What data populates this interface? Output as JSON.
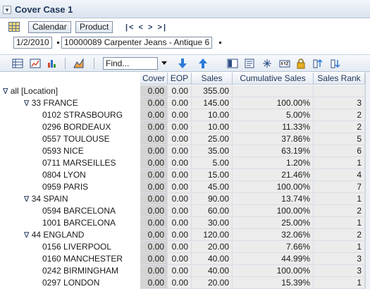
{
  "title": "Cover Case 1",
  "collapse_glyph": "▾",
  "dimensions": {
    "calendar_label": "Calendar",
    "product_label": "Product",
    "nav_glyphs": "|< < > >|",
    "date_crumb": "1/2/2010",
    "product_crumb": "10000089 Carpenter Jeans - Antique 6"
  },
  "toolbar": {
    "find_placeholder": "Find...",
    "icons": [
      "grid-view-icon",
      "chart-view-icon",
      "bar-chart-icon",
      "area-chart-icon",
      "find-next-icon",
      "find-previous-icon",
      "spreadsheet-icon",
      "filter-icon",
      "xyz-icon",
      "lock-icon",
      "sort-up-icon",
      "sort-down-icon"
    ]
  },
  "grid": {
    "columns": [
      "Cover",
      "EOP",
      "Sales",
      "Cumulative Sales",
      "Sales Rank"
    ],
    "rows": [
      {
        "label": "all [Location]",
        "twisty": "∇",
        "cover": "0.00",
        "eop": "0.00",
        "sales": "355.00",
        "cum": "",
        "rank": ""
      },
      {
        "label": "33 FRANCE",
        "twisty": "∇",
        "cover": "0.00",
        "eop": "0.00",
        "sales": "145.00",
        "cum": "100.00%",
        "rank": "3"
      },
      {
        "label": "0102 STRASBOURG",
        "twisty": "",
        "cover": "0.00",
        "eop": "0.00",
        "sales": "10.00",
        "cum": "5.00%",
        "rank": "2"
      },
      {
        "label": "0296 BORDEAUX",
        "twisty": "",
        "cover": "0.00",
        "eop": "0.00",
        "sales": "10.00",
        "cum": "11.33%",
        "rank": "2"
      },
      {
        "label": "0557 TOULOUSE",
        "twisty": "",
        "cover": "0.00",
        "eop": "0.00",
        "sales": "25.00",
        "cum": "37.86%",
        "rank": "5"
      },
      {
        "label": "0593 NICE",
        "twisty": "",
        "cover": "0.00",
        "eop": "0.00",
        "sales": "35.00",
        "cum": "63.19%",
        "rank": "6"
      },
      {
        "label": "0711 MARSEILLES",
        "twisty": "",
        "cover": "0.00",
        "eop": "0.00",
        "sales": "5.00",
        "cum": "1.20%",
        "rank": "1"
      },
      {
        "label": "0804 LYON",
        "twisty": "",
        "cover": "0.00",
        "eop": "0.00",
        "sales": "15.00",
        "cum": "21.46%",
        "rank": "4"
      },
      {
        "label": "0959 PARIS",
        "twisty": "",
        "cover": "0.00",
        "eop": "0.00",
        "sales": "45.00",
        "cum": "100.00%",
        "rank": "7"
      },
      {
        "label": "34 SPAIN",
        "twisty": "∇",
        "cover": "0.00",
        "eop": "0.00",
        "sales": "90.00",
        "cum": "13.74%",
        "rank": "1"
      },
      {
        "label": "0594 BARCELONA",
        "twisty": "",
        "cover": "0.00",
        "eop": "0.00",
        "sales": "60.00",
        "cum": "100.00%",
        "rank": "2"
      },
      {
        "label": "1001 BARCELONA",
        "twisty": "",
        "cover": "0.00",
        "eop": "0.00",
        "sales": "30.00",
        "cum": "25.00%",
        "rank": "1"
      },
      {
        "label": "44 ENGLAND",
        "twisty": "∇",
        "cover": "0.00",
        "eop": "0.00",
        "sales": "120.00",
        "cum": "32.06%",
        "rank": "2"
      },
      {
        "label": "0156 LIVERPOOL",
        "twisty": "",
        "cover": "0.00",
        "eop": "0.00",
        "sales": "20.00",
        "cum": "7.66%",
        "rank": "1"
      },
      {
        "label": "0160 MANCHESTER",
        "twisty": "",
        "cover": "0.00",
        "eop": "0.00",
        "sales": "40.00",
        "cum": "44.99%",
        "rank": "3"
      },
      {
        "label": "0242 BIRMINGHAM",
        "twisty": "",
        "cover": "0.00",
        "eop": "0.00",
        "sales": "40.00",
        "cum": "100.00%",
        "rank": "3"
      },
      {
        "label": "0297 LONDON",
        "twisty": "",
        "cover": "0.00",
        "eop": "0.00",
        "sales": "20.00",
        "cum": "15.39%",
        "rank": "1"
      }
    ]
  }
}
